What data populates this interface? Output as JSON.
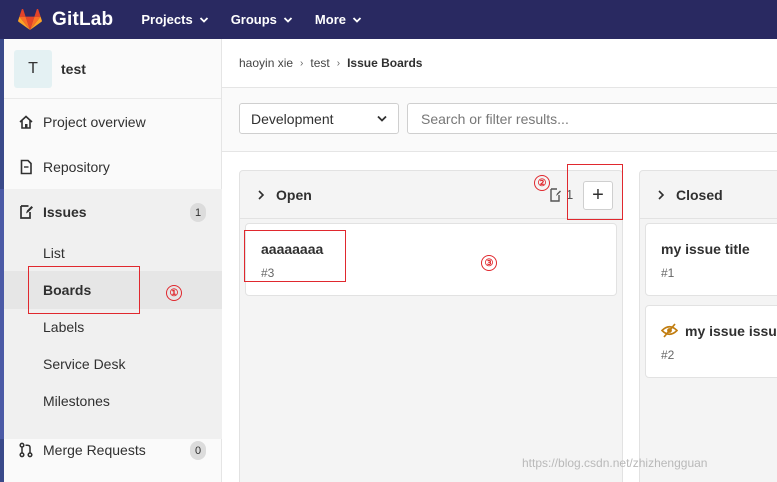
{
  "navbar": {
    "brand": "GitLab",
    "menus": [
      "Projects",
      "Groups",
      "More"
    ]
  },
  "sidebar": {
    "avatar_letter": "T",
    "project_name": "test",
    "items": [
      {
        "label": "Project overview",
        "icon": "home-icon"
      },
      {
        "label": "Repository",
        "icon": "document-icon"
      },
      {
        "label": "Issues",
        "icon": "issues-icon",
        "badge": "1"
      },
      {
        "label": "Merge Requests",
        "icon": "merge-request-icon",
        "badge": "0"
      }
    ],
    "issues_sub": [
      "List",
      "Boards",
      "Labels",
      "Service Desk",
      "Milestones"
    ]
  },
  "breadcrumb": [
    "haoyin xie",
    "test",
    "Issue Boards"
  ],
  "filters": {
    "board_select": "Development",
    "search_placeholder": "Search or filter results..."
  },
  "board": {
    "lists": [
      {
        "title": "Open",
        "issue_count": "1",
        "cards": [
          {
            "title": "aaaaaaaa",
            "number": "#3"
          }
        ]
      },
      {
        "title": "Closed",
        "cards": [
          {
            "title": "my issue title",
            "number": "#1"
          },
          {
            "title": "my issue issue",
            "number": "#2",
            "confidential": true
          }
        ]
      }
    ]
  },
  "annotations": [
    "①",
    "②",
    "③"
  ],
  "watermark": "https://blog.csdn.net/zhizhengguan",
  "colors": {
    "navbar": "#292961",
    "accent": "#4b5aa6",
    "annotation_red": "#e0282e",
    "confidential_orange": "#c17d10"
  }
}
